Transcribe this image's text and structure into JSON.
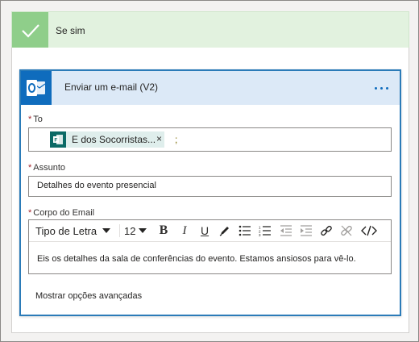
{
  "branch": {
    "label": "Se sim"
  },
  "action": {
    "title": "Enviar um e-mail (V2)",
    "more_icon": "more-icon"
  },
  "fields": {
    "to": {
      "label": "To",
      "token": "E dos Socorristas...",
      "token_remove": "×",
      "separator": ";"
    },
    "subject": {
      "label": "Assunto",
      "value": "Detalhes do evento presencial"
    },
    "body": {
      "label": "Corpo do Email",
      "value": "Eis os detalhes da sala de conferências do evento. Estamos ansiosos para vê-lo."
    }
  },
  "toolbar": {
    "font_family": "Tipo de Letra",
    "font_size": "12",
    "bold": "B",
    "italic": "I",
    "underline": "U"
  },
  "advanced_options": "Mostrar opções avançadas",
  "colors": {
    "branch_accent": "#8fce8a",
    "branch_header": "#e2f2df",
    "card_border": "#2b7bb8",
    "card_header": "#dce9f7",
    "outlook_blue": "#0f6cbd",
    "token_bg": "#dfeeec",
    "token_icon": "#0b6a66"
  }
}
